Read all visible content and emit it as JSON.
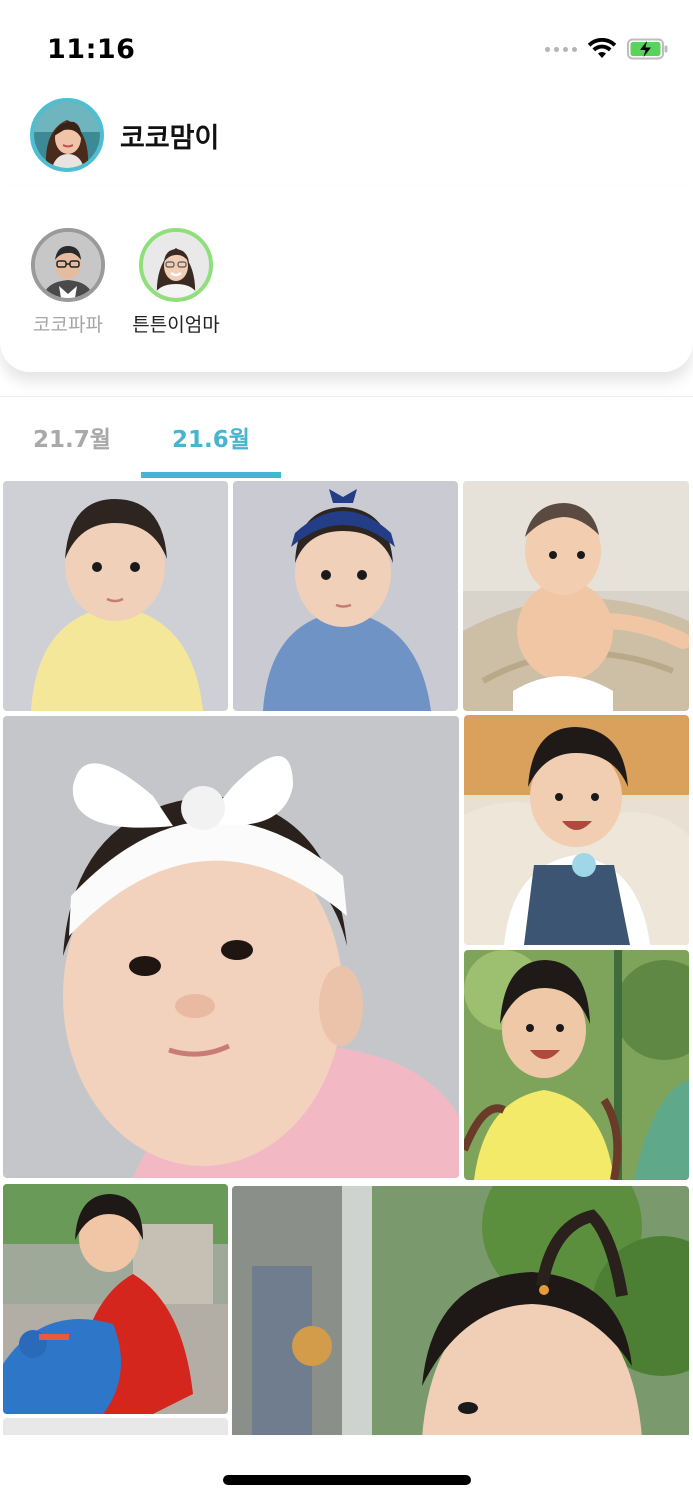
{
  "status_bar": {
    "time": "11:16",
    "icons": [
      "cellular-signal-icon",
      "wifi-icon",
      "battery-charging-icon"
    ]
  },
  "profile": {
    "name": "코코맘이",
    "avatar_icon": "user-avatar"
  },
  "family_members": [
    {
      "label": "코코파파",
      "selected": false
    },
    {
      "label": "튼튼이엄마",
      "selected": true
    }
  ],
  "tabs": [
    {
      "label": "21.7월",
      "active": false
    },
    {
      "label": "21.6월",
      "active": true
    }
  ],
  "photos": [
    {
      "name": "baby-yellow-top",
      "bg": "#cfd0d6"
    },
    {
      "name": "baby-blue-headband",
      "bg": "#c9cad2"
    },
    {
      "name": "baby-wicker-chair",
      "bg": "#d8d4cc"
    },
    {
      "name": "baby-white-bow-closeup",
      "bg": "#c5c6ca"
    },
    {
      "name": "baby-smiling-overalls",
      "bg": "#d9a15c"
    },
    {
      "name": "baby-yellow-shirt-outdoor",
      "bg": "#7ea45b"
    },
    {
      "name": "baby-red-dress-toy",
      "bg": "#9fa99a"
    },
    {
      "name": "baby-ponytail-outdoor",
      "bg": "#7a9a6e"
    }
  ],
  "colors": {
    "accent": "#46b6d0",
    "active_ring": "#8fe07b",
    "inactive_ring": "#9a9a9a"
  }
}
